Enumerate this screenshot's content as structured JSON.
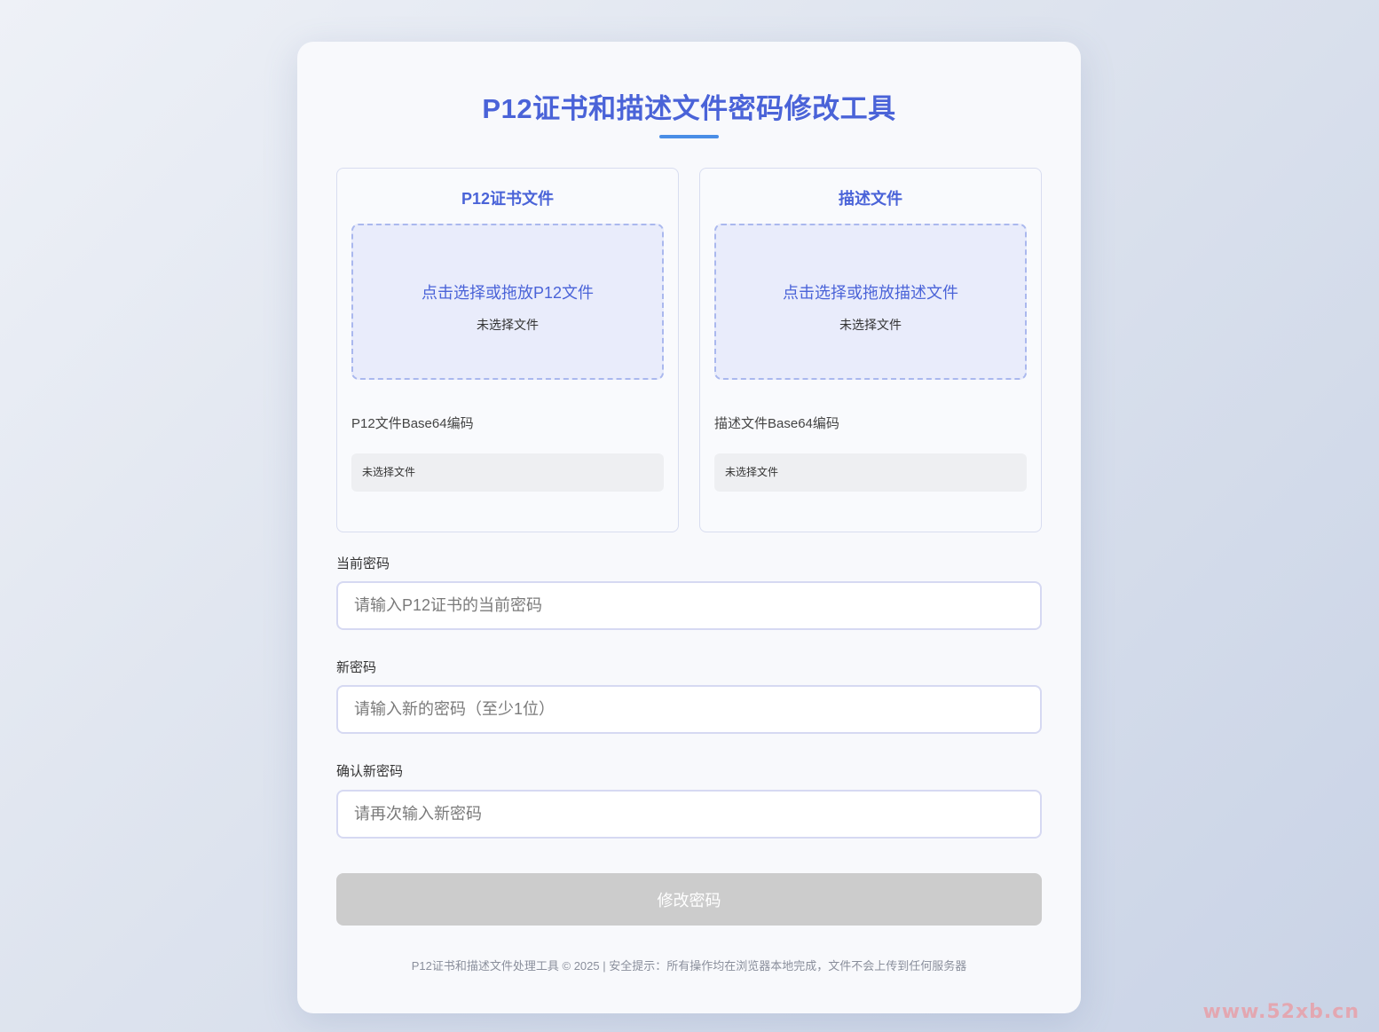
{
  "page": {
    "title": "P12证书和描述文件密码修改工具"
  },
  "p12_panel": {
    "title": "P12证书文件",
    "drop_text": "点击选择或拖放P12文件",
    "status": "未选择文件",
    "base64_label": "P12文件Base64编码",
    "base64_value": "未选择文件"
  },
  "profile_panel": {
    "title": "描述文件",
    "drop_text": "点击选择或拖放描述文件",
    "status": "未选择文件",
    "base64_label": "描述文件Base64编码",
    "base64_value": "未选择文件"
  },
  "form": {
    "current_password_label": "当前密码",
    "current_password_placeholder": "请输入P12证书的当前密码",
    "current_password_value": "",
    "new_password_label": "新密码",
    "new_password_placeholder": "请输入新的密码（至少1位）",
    "new_password_value": "",
    "confirm_password_label": "确认新密码",
    "confirm_password_placeholder": "请再次输入新密码",
    "confirm_password_value": "",
    "submit_label": "修改密码"
  },
  "footer": {
    "text": "P12证书和描述文件处理工具 © 2025 | 安全提示：所有操作均在浏览器本地完成，文件不会上传到任何服务器"
  },
  "watermark": {
    "text": "www.52xb.cn"
  },
  "colors": {
    "accent": "#4a63d8",
    "underline": "#4a8ee6",
    "drop_zone_bg": "#e9ecfb",
    "button_disabled": "#cccccc",
    "watermark": "#e8a0a8"
  }
}
